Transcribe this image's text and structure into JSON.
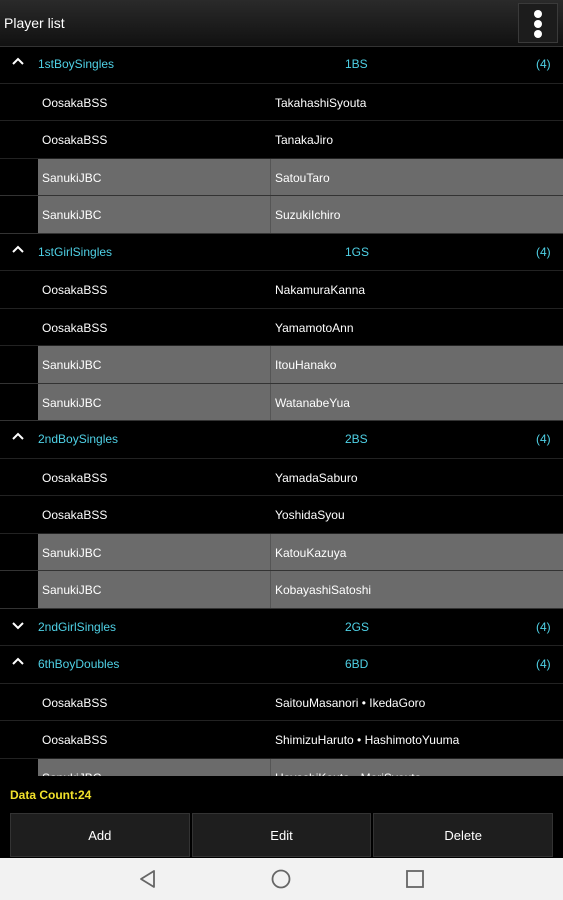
{
  "app": {
    "title": "Player list",
    "menu_icon": "overflow-menu-icon"
  },
  "groups": [
    {
      "name": "1stBoySingles",
      "code": "1BS",
      "count": "(4)",
      "expanded": true,
      "rows": [
        {
          "team": "OosakaBSS",
          "player": "TakahashiSyouta",
          "selected": false
        },
        {
          "team": "OosakaBSS",
          "player": "TanakaJiro",
          "selected": false
        },
        {
          "team": "SanukiJBC",
          "player": "SatouTaro",
          "selected": true
        },
        {
          "team": "SanukiJBC",
          "player": "SuzukiIchiro",
          "selected": true
        }
      ]
    },
    {
      "name": "1stGirlSingles",
      "code": "1GS",
      "count": "(4)",
      "expanded": true,
      "rows": [
        {
          "team": "OosakaBSS",
          "player": "NakamuraKanna",
          "selected": false
        },
        {
          "team": "OosakaBSS",
          "player": "YamamotoAnn",
          "selected": false
        },
        {
          "team": "SanukiJBC",
          "player": "ItouHanako",
          "selected": true
        },
        {
          "team": "SanukiJBC",
          "player": "WatanabeYua",
          "selected": true
        }
      ]
    },
    {
      "name": "2ndBoySingles",
      "code": "2BS",
      "count": "(4)",
      "expanded": true,
      "rows": [
        {
          "team": "OosakaBSS",
          "player": "YamadaSaburo",
          "selected": false
        },
        {
          "team": "OosakaBSS",
          "player": "YoshidaSyou",
          "selected": false
        },
        {
          "team": "SanukiJBC",
          "player": "KatouKazuya",
          "selected": true
        },
        {
          "team": "SanukiJBC",
          "player": "KobayashiSatoshi",
          "selected": true
        }
      ]
    },
    {
      "name": "2ndGirlSingles",
      "code": "2GS",
      "count": "(4)",
      "expanded": false,
      "rows": []
    },
    {
      "name": "6thBoyDoubles",
      "code": "6BD",
      "count": "(4)",
      "expanded": true,
      "rows": [
        {
          "team": "OosakaBSS",
          "player": "SaitouMasanori • IkedaGoro",
          "selected": false
        },
        {
          "team": "OosakaBSS",
          "player": "ShimizuHaruto • HashimotoYuuma",
          "selected": false
        },
        {
          "team": "SanukiJBC",
          "player": "HayashiKouta • MoriSyouta",
          "selected": true
        }
      ]
    }
  ],
  "footer": {
    "data_count": "Data Count:24",
    "buttons": {
      "add": "Add",
      "edit": "Edit",
      "delete": "Delete"
    }
  },
  "navbar": {
    "back_icon": "back-icon",
    "home_icon": "home-icon",
    "recents_icon": "recents-icon"
  },
  "colors": {
    "group_text": "#4fd1e6",
    "count_text": "#f2e12b",
    "selected_row": "#6b6b6b"
  }
}
